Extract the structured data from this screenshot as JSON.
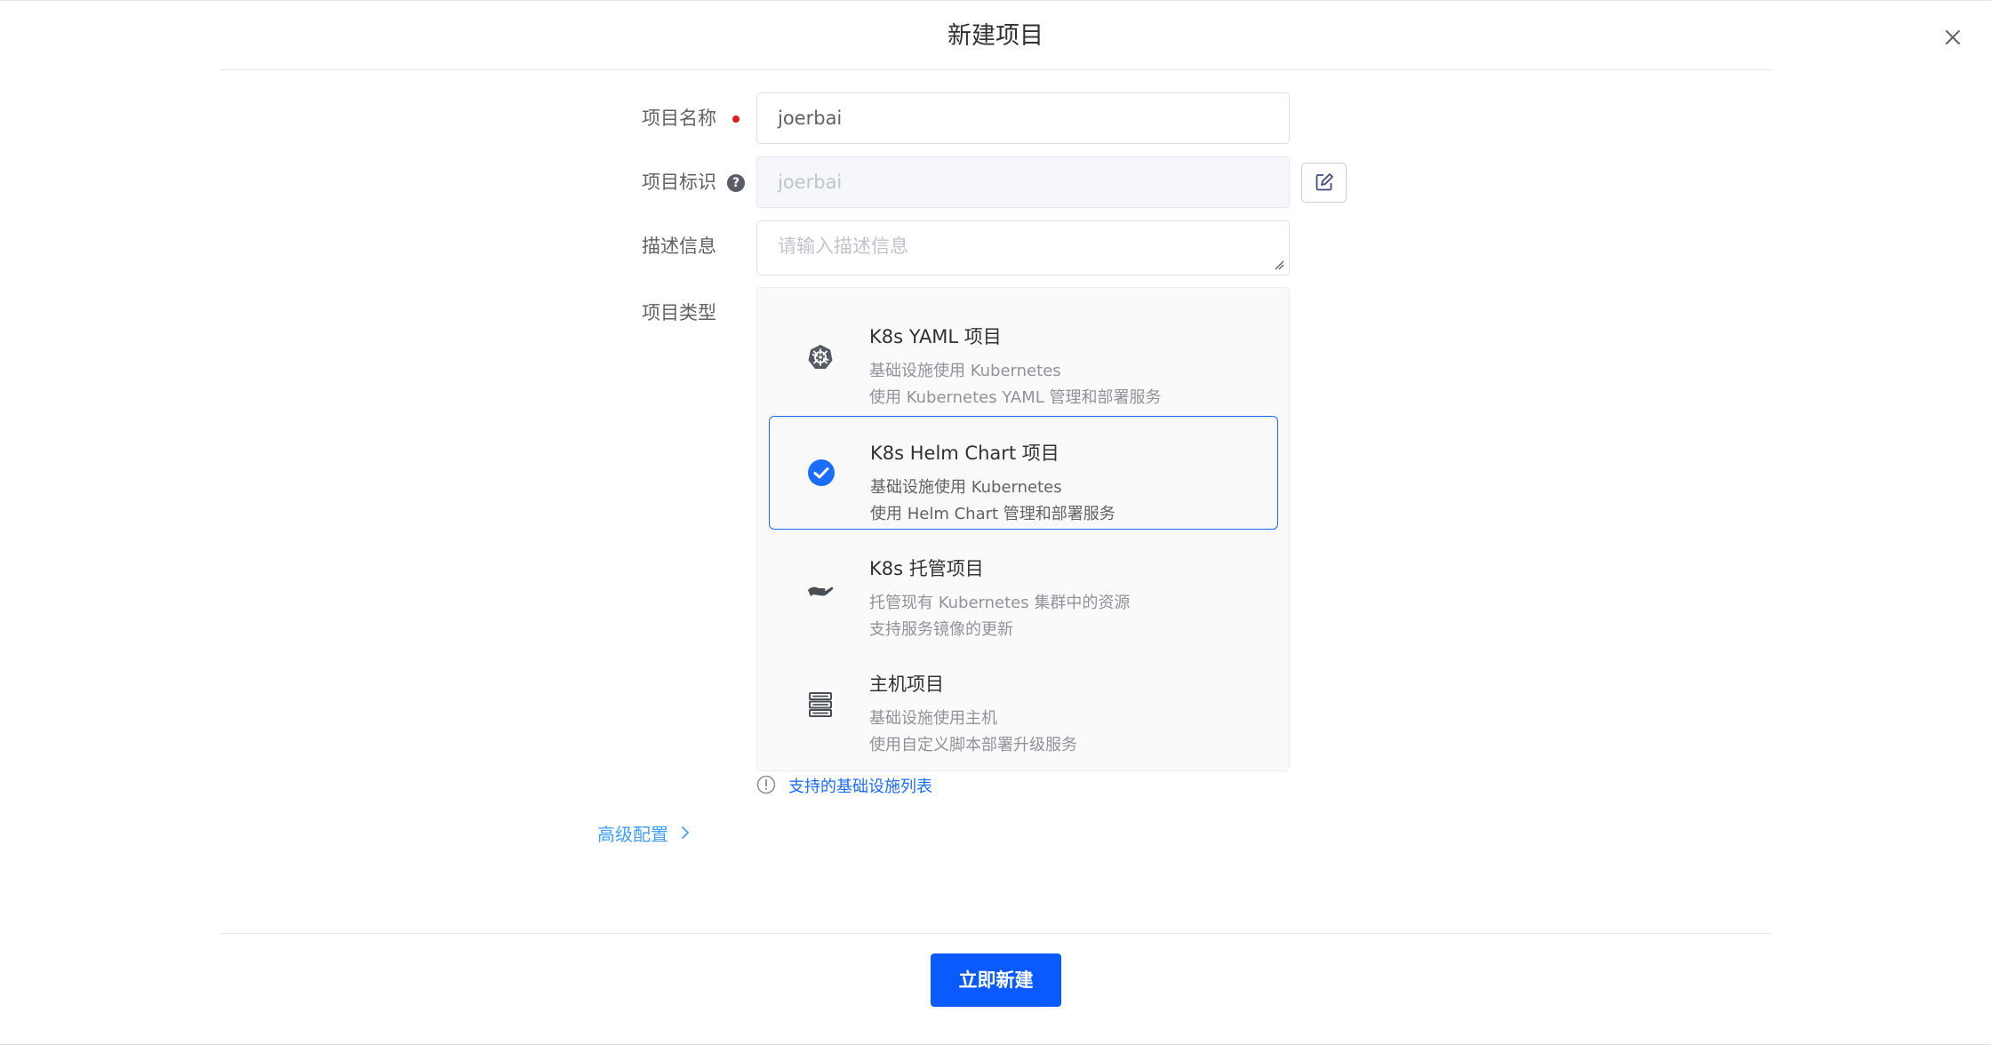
{
  "dialog": {
    "title": "新建项目",
    "close_icon": "close-icon"
  },
  "form": {
    "name_label": "项目名称",
    "name_value": "joerbai",
    "key_label": "项目标识",
    "key_value": "joerbai",
    "desc_label": "描述信息",
    "desc_placeholder": "请输入描述信息",
    "type_label": "项目类型"
  },
  "project_types": [
    {
      "title": "K8s YAML 项目",
      "line1": "基础设施使用 Kubernetes",
      "line2": "使用 Kubernetes YAML 管理和部署服务",
      "icon": "kubernetes-helm-icon",
      "selected": false
    },
    {
      "title": "K8s Helm Chart 项目",
      "line1": "基础设施使用 Kubernetes",
      "line2": "使用 Helm Chart 管理和部署服务",
      "icon": "check-circle-icon",
      "selected": true
    },
    {
      "title": "K8s 托管项目",
      "line1": "托管现有 Kubernetes 集群中的资源",
      "line2": "支持服务镜像的更新",
      "icon": "hand-icon",
      "selected": false
    },
    {
      "title": "主机项目",
      "line1": "基础设施使用主机",
      "line2": "使用自定义脚本部署升级服务",
      "icon": "server-icon",
      "selected": false
    }
  ],
  "infra_link": "支持的基础设施列表",
  "advanced": "高级配置",
  "submit_label": "立即新建",
  "colors": {
    "primary": "#0a5bff",
    "link": "#409eff",
    "required": "#e02020"
  }
}
